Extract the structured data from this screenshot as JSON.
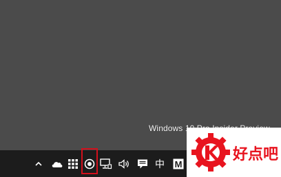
{
  "desktop": {
    "watermark": "Windows 10 Pro Insider Preview"
  },
  "taskbar": {
    "tray_icons": [
      "chevron-up-icon",
      "onedrive-cloud-icon",
      "app-grid-icon",
      "screen-record-icon",
      "network-icon",
      "volume-icon",
      "action-center-icon",
      "ime-language-icon",
      "m-app-icon"
    ],
    "ime_label": "中",
    "m_label": "M",
    "highlight_color": "#d4101c"
  },
  "logo": {
    "text": "好点吧",
    "color": "#e8141f"
  }
}
